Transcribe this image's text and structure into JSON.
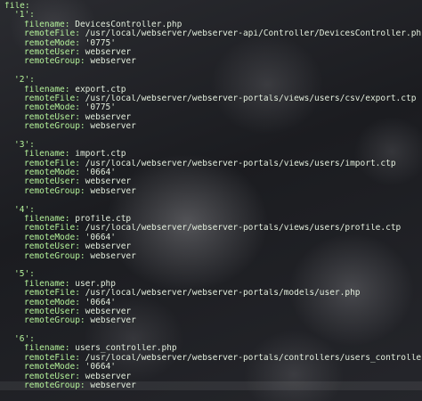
{
  "root_key": "file:",
  "files": [
    {
      "index": "'1':",
      "filename_key": "filename:",
      "filename": "DevicesController.php",
      "remoteFile_key": "remoteFile:",
      "remoteFile": "/usr/local/webserver/webserver-api/Controller/DevicesController.php",
      "remoteMode_key": "remoteMode:",
      "remoteMode": "'0775'",
      "remoteUser_key": "remoteUser:",
      "remoteUser": "webserver",
      "remoteGroup_key": "remoteGroup:",
      "remoteGroup": "webserver"
    },
    {
      "index": "'2':",
      "filename_key": "filename:",
      "filename": "export.ctp",
      "remoteFile_key": "remoteFile:",
      "remoteFile": "/usr/local/webserver/webserver-portals/views/users/csv/export.ctp",
      "remoteMode_key": "remoteMode:",
      "remoteMode": "'0775'",
      "remoteUser_key": "remoteUser:",
      "remoteUser": "webserver",
      "remoteGroup_key": "remoteGroup:",
      "remoteGroup": "webserver"
    },
    {
      "index": "'3':",
      "filename_key": "filename:",
      "filename": "import.ctp",
      "remoteFile_key": "remoteFile:",
      "remoteFile": "/usr/local/webserver/webserver-portals/views/users/import.ctp",
      "remoteMode_key": "remoteMode:",
      "remoteMode": "'0664'",
      "remoteUser_key": "remoteUser:",
      "remoteUser": "webserver",
      "remoteGroup_key": "remoteGroup:",
      "remoteGroup": "webserver"
    },
    {
      "index": "'4':",
      "filename_key": "filename:",
      "filename": "profile.ctp",
      "remoteFile_key": "remoteFile:",
      "remoteFile": "/usr/local/webserver/webserver-portals/views/users/profile.ctp",
      "remoteMode_key": "remoteMode:",
      "remoteMode": "'0664'",
      "remoteUser_key": "remoteUser:",
      "remoteUser": "webserver",
      "remoteGroup_key": "remoteGroup:",
      "remoteGroup": "webserver"
    },
    {
      "index": "'5':",
      "filename_key": "filename:",
      "filename": "user.php",
      "remoteFile_key": "remoteFile:",
      "remoteFile": "/usr/local/webserver/webserver-portals/models/user.php",
      "remoteMode_key": "remoteMode:",
      "remoteMode": "'0664'",
      "remoteUser_key": "remoteUser:",
      "remoteUser": "webserver",
      "remoteGroup_key": "remoteGroup:",
      "remoteGroup": "webserver"
    },
    {
      "index": "'6':",
      "filename_key": "filename:",
      "filename": "users_controller.php",
      "remoteFile_key": "remoteFile:",
      "remoteFile": "/usr/local/webserver/webserver-portals/controllers/users_controller.php",
      "remoteMode_key": "remoteMode:",
      "remoteMode": "'0664'",
      "remoteUser_key": "remoteUser:",
      "remoteUser": "webserver",
      "remoteGroup_key": "remoteGroup:",
      "remoteGroup": "webserver"
    }
  ],
  "colors": {
    "key": "#b4f29a",
    "value": "#e3eedd",
    "background": "#1f2024"
  }
}
